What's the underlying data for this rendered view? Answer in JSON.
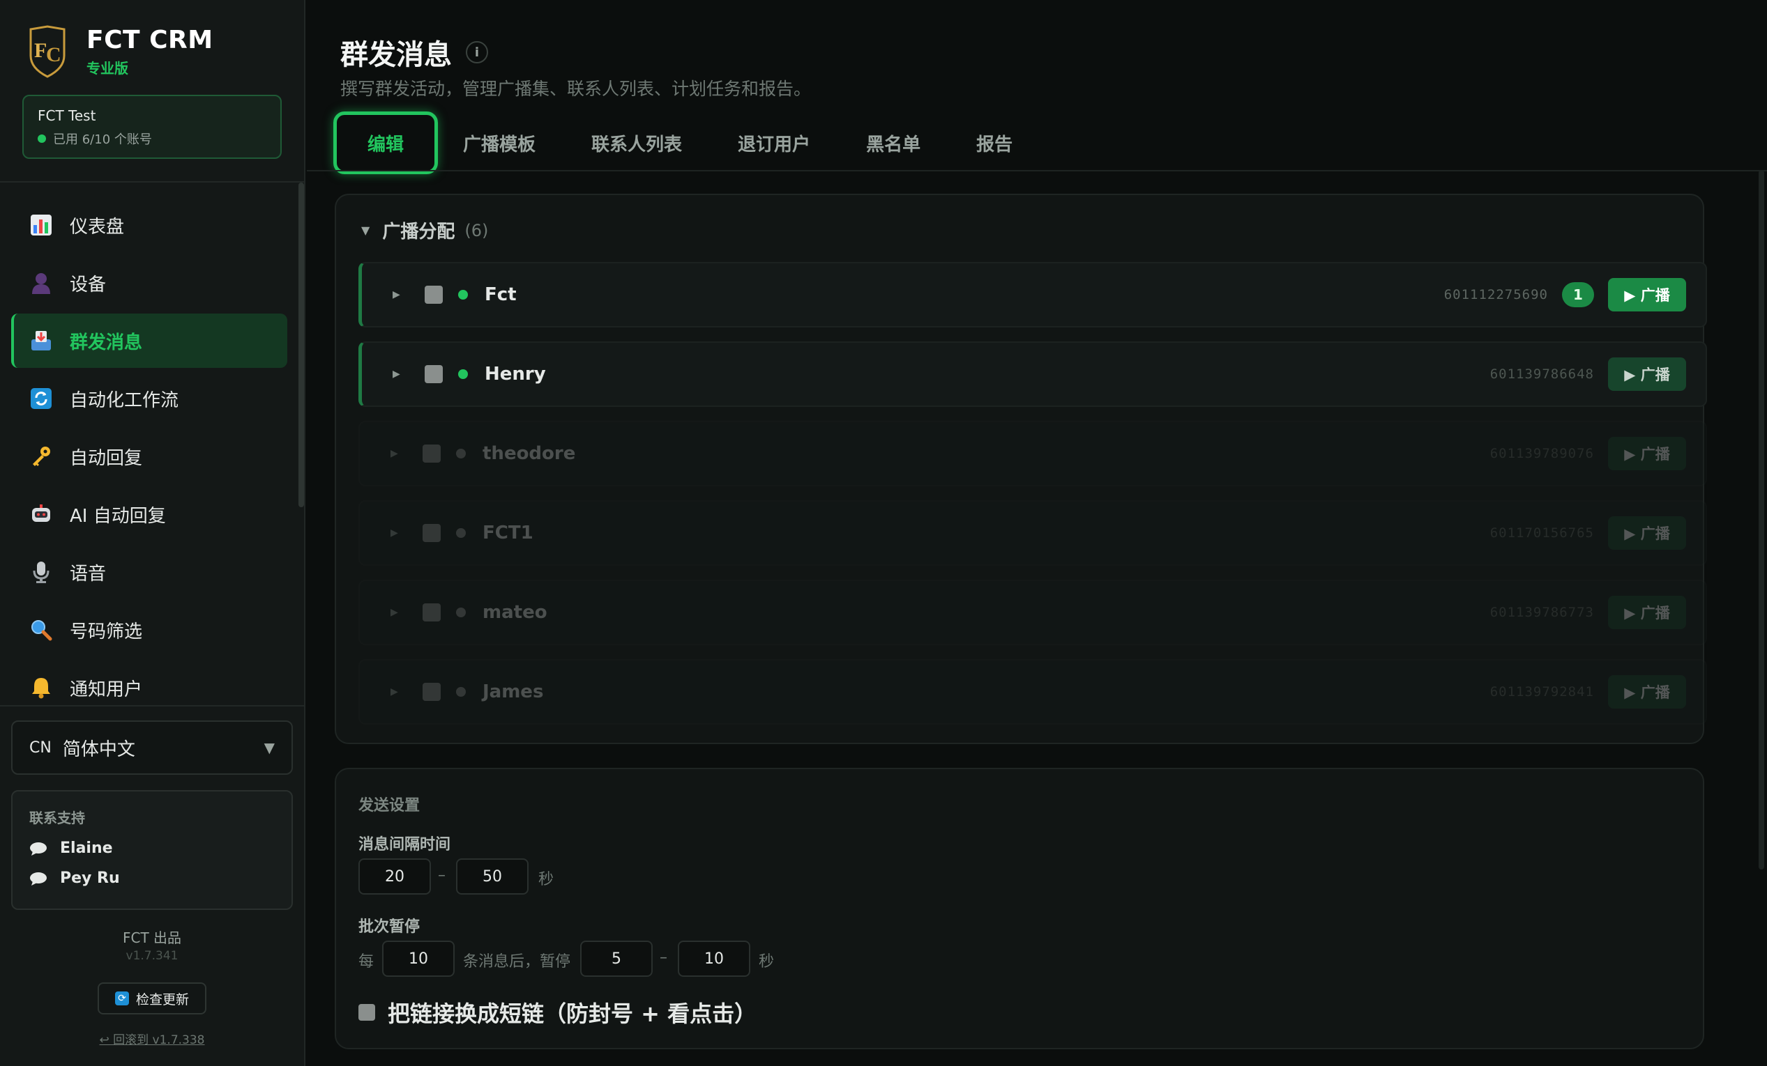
{
  "brand": {
    "name": "FCT CRM",
    "edition": "专业版"
  },
  "account": {
    "name": "FCT Test",
    "usage": "已用 6/10 个账号"
  },
  "nav": [
    {
      "label": "仪表盘",
      "icon": "bar-chart-icon"
    },
    {
      "label": "设备",
      "icon": "user-silhouette-icon"
    },
    {
      "label": "群发消息",
      "icon": "inbox-tray-icon",
      "active": true
    },
    {
      "label": "自动化工作流",
      "icon": "refresh-icon"
    },
    {
      "label": "自动回复",
      "icon": "key-icon"
    },
    {
      "label": "AI 自动回复",
      "icon": "robot-icon"
    },
    {
      "label": "语音",
      "icon": "microphone-icon"
    },
    {
      "label": "号码筛选",
      "icon": "magnifier-icon"
    },
    {
      "label": "通知用户",
      "icon": "bell-icon"
    }
  ],
  "language": {
    "code": "CN",
    "label": "简体中文"
  },
  "support": {
    "title": "联系支持",
    "contacts": [
      "Elaine",
      "Pey Ru"
    ]
  },
  "footer": {
    "maker": "FCT 出品",
    "version": "v1.7.341",
    "check_update": "检查更新",
    "rollback": "↩ 回滚到 v1.7.338"
  },
  "page": {
    "title": "群发消息",
    "subtitle": "撰写群发活动，管理广播集、联系人列表、计划任务和报告。"
  },
  "tabs": [
    "编辑",
    "广播模板",
    "联系人列表",
    "退订用户",
    "黑名单",
    "报告"
  ],
  "distribution": {
    "title": "广播分配",
    "count": "(6)",
    "broadcast_label": "▶ 广播",
    "accounts": [
      {
        "name": "Fct",
        "phone": "601112275690",
        "badge": "1",
        "online": true
      },
      {
        "name": "Henry",
        "phone": "601139786648",
        "online": true
      },
      {
        "name": "theodore",
        "phone": "601139789076",
        "online": false
      },
      {
        "name": "FCT1",
        "phone": "601170156765",
        "online": false
      },
      {
        "name": "mateo",
        "phone": "601139786773",
        "online": false
      },
      {
        "name": "James",
        "phone": "601139792841",
        "online": false
      }
    ]
  },
  "settings": {
    "title": "发送设置",
    "interval": {
      "label": "消息间隔时间",
      "min": "20",
      "sep": "–",
      "max": "50",
      "unit": "秒"
    },
    "batch": {
      "label": "批次暂停",
      "prefix": "每",
      "count": "10",
      "middle": "条消息后，暂停",
      "min": "5",
      "sep": "–",
      "max": "10",
      "unit": "秒"
    },
    "shortlink": "把链接换成短链（防封号 + 看点击）"
  },
  "colors": {
    "accent": "#22c55e",
    "background": "#0b0e0d",
    "sidebar": "#141817"
  }
}
